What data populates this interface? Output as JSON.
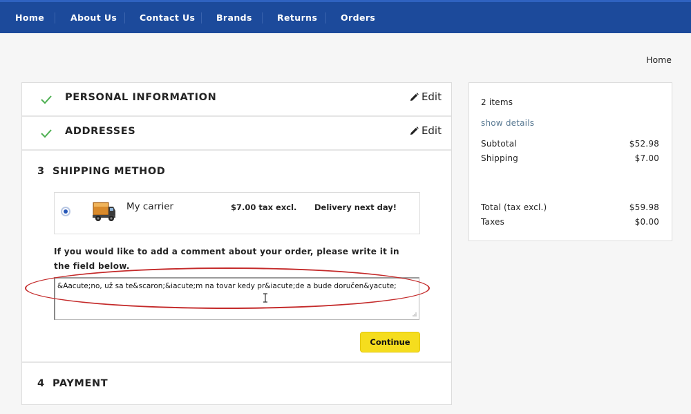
{
  "nav": {
    "items": [
      {
        "label": "Home"
      },
      {
        "label": "About Us"
      },
      {
        "label": "Contact Us"
      },
      {
        "label": "Brands"
      },
      {
        "label": "Returns"
      },
      {
        "label": "Orders"
      }
    ]
  },
  "breadcrumb": {
    "current": "Home"
  },
  "checkout": {
    "personal": {
      "title": "PERSONAL INFORMATION",
      "edit_label": "Edit",
      "status_icon": "check-icon"
    },
    "addresses": {
      "title": "ADDRESSES",
      "edit_label": "Edit",
      "status_icon": "check-icon"
    },
    "shipping": {
      "number": "3",
      "title": "SHIPPING METHOD",
      "carrier": {
        "selected": true,
        "name": "My carrier",
        "price": "$7.00 tax excl.",
        "delay": "Delivery next day!",
        "icon": "delivery-truck-icon"
      },
      "comment_label": "If you would like to add a comment about your order, please write it in the field below.",
      "comment_value": "&Aacute;no, už sa te&scaron;&iacute;m na tovar kedy pr&iacute;de a bude doručen&yacute;",
      "continue_label": "Continue"
    },
    "payment": {
      "number": "4",
      "title": "PAYMENT"
    }
  },
  "summary": {
    "items_count": "2 items",
    "show_details": "show details",
    "subtotal_label": "Subtotal",
    "subtotal_value": "$52.98",
    "shipping_label": "Shipping",
    "shipping_value": "$7.00",
    "total_label": "Total (tax excl.)",
    "total_value": "$59.98",
    "taxes_label": "Taxes",
    "taxes_value": "$0.00"
  },
  "colors": {
    "nav_bg": "#1c4a9b",
    "accent_button": "#f5dd1e",
    "check_green": "#4caf50",
    "annotation_red": "#c42a2a"
  }
}
